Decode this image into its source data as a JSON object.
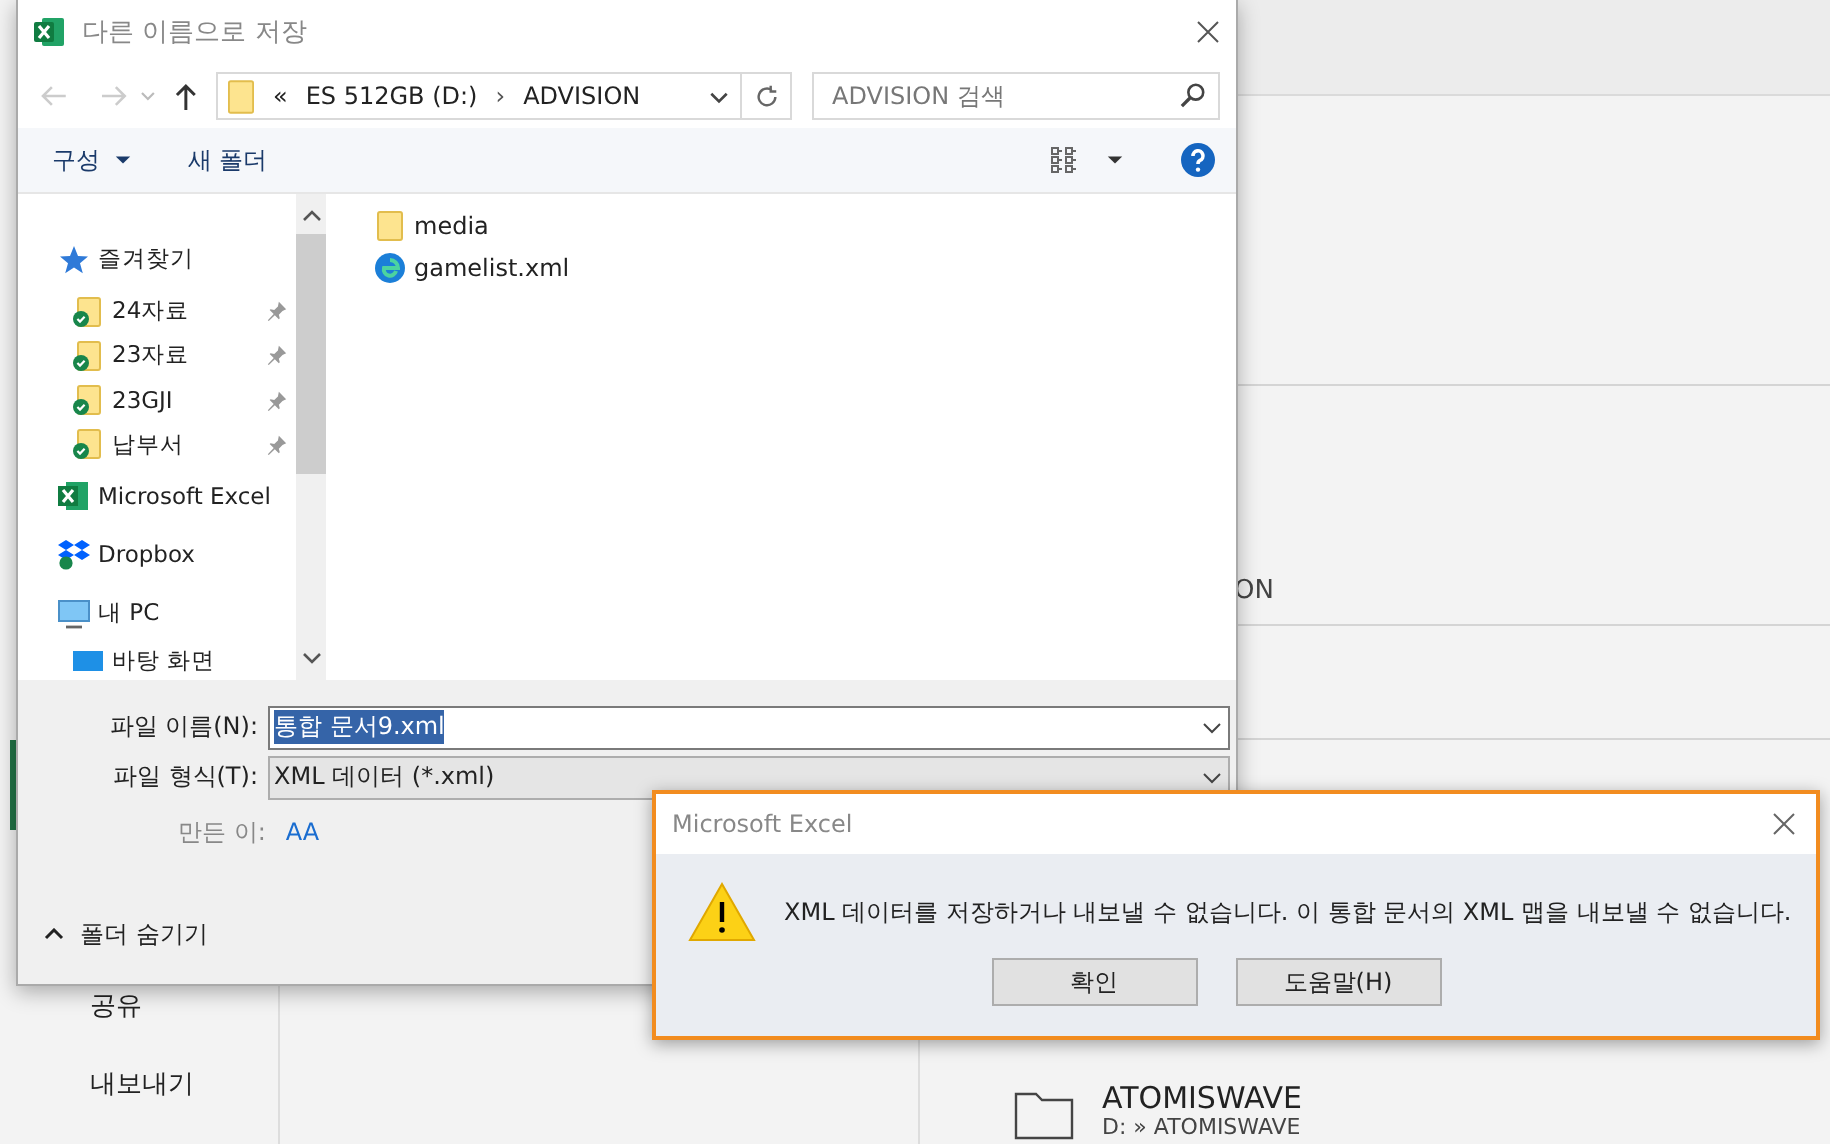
{
  "backstage": {
    "nav_items": [
      {
        "label": "공유"
      },
      {
        "label": "내보내기"
      }
    ],
    "fragment": "ON",
    "recent_folder": {
      "name": "ATOMISWAVE",
      "path": "D: » ATOMISWAVE"
    }
  },
  "save_dialog": {
    "title": "다른 이름으로 저장",
    "back_disabled": true,
    "forward_disabled": true,
    "address": {
      "overflow": "«",
      "segments": [
        "ES 512GB (D:)",
        "ADVISION"
      ],
      "separator": "›"
    },
    "search": {
      "placeholder": "ADVISION 검색"
    },
    "toolbar": {
      "organize": "구성",
      "new_folder": "새 폴더"
    },
    "nav_items": [
      {
        "kind": "favorites",
        "label": "즐겨찾기",
        "pinned": false
      },
      {
        "kind": "synced-folder",
        "label": "24자료",
        "pinned": true
      },
      {
        "kind": "synced-folder",
        "label": "23자료",
        "pinned": true
      },
      {
        "kind": "synced-folder",
        "label": "23GJI",
        "pinned": true
      },
      {
        "kind": "synced-folder",
        "label": "납부서",
        "pinned": true
      },
      {
        "kind": "excel",
        "label": "Microsoft Excel",
        "pinned": false
      },
      {
        "kind": "dropbox",
        "label": "Dropbox",
        "pinned": false
      },
      {
        "kind": "pc",
        "label": "내 PC",
        "pinned": false
      },
      {
        "kind": "desktop",
        "label": "바탕 화면",
        "pinned": false
      }
    ],
    "files": [
      {
        "kind": "folder",
        "name": "media"
      },
      {
        "kind": "edge-document",
        "name": "gamelist.xml"
      }
    ],
    "file_name": {
      "label": "파일 이름(N):",
      "value": "통합 문서9.xml",
      "selected": true
    },
    "file_type": {
      "label": "파일 형식(T):",
      "value": "XML 데이터 (*.xml)"
    },
    "author": {
      "label": "만든 이:",
      "value": "AA"
    },
    "hide_folders": "폴더 숨기기"
  },
  "alert": {
    "title": "Microsoft Excel",
    "message": "XML 데이터를 저장하거나 내보낼 수 없습니다. 이 통합 문서의 XML 맵을 내보낼 수 없습니다.",
    "buttons": [
      "확인",
      "도움말(H)"
    ]
  }
}
